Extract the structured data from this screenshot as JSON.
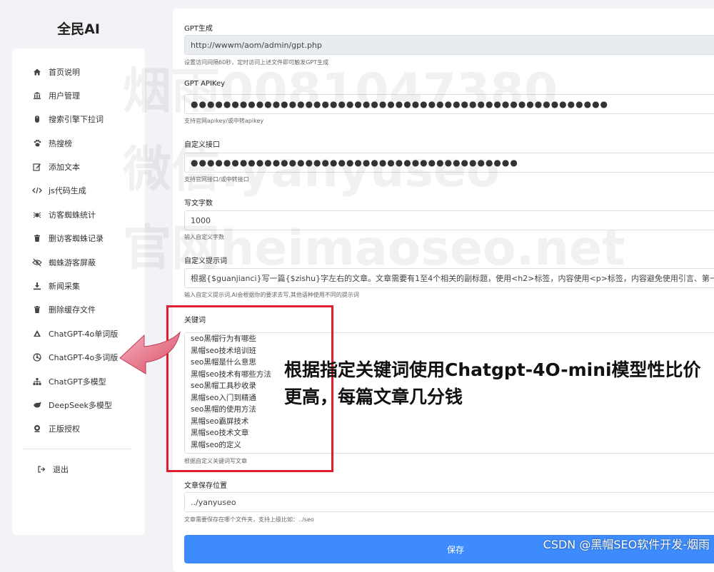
{
  "app": {
    "title": "全民AI"
  },
  "sidebar": {
    "items": [
      {
        "label": "首页说明",
        "icon": "home-icon"
      },
      {
        "label": "用户管理",
        "icon": "users-icon"
      },
      {
        "label": "搜索引擎下拉词",
        "icon": "mouse-icon"
      },
      {
        "label": "热搜榜",
        "icon": "paw-icon"
      },
      {
        "label": "添加文本",
        "icon": "edit-icon"
      },
      {
        "label": "js代码生成",
        "icon": "code-icon"
      },
      {
        "label": "访客蜘蛛统计",
        "icon": "spider-icon"
      },
      {
        "label": "删访客蜘蛛记录",
        "icon": "trash-icon"
      },
      {
        "label": "蜘蛛游客屏蔽",
        "icon": "eye-slash-icon"
      },
      {
        "label": "新闻采集",
        "icon": "download-icon"
      },
      {
        "label": "删除缓存文件",
        "icon": "trash-icon"
      },
      {
        "label": "ChatGPT-4o单词版",
        "icon": "chatgpt-icon"
      },
      {
        "label": "ChatGPT-4o多词版",
        "icon": "chatgpt-icon"
      },
      {
        "label": "ChatGPT多模型",
        "icon": "sitemap-icon"
      },
      {
        "label": "DeepSeek多模型",
        "icon": "deepseek-icon"
      },
      {
        "label": "正版授权",
        "icon": "license-icon"
      }
    ],
    "logout": {
      "label": "退出",
      "icon": "logout-icon"
    }
  },
  "form": {
    "gpt_url": {
      "label": "GPT生成",
      "value": "http://wwwm/aom/admin/gpt.php",
      "hint": "设置访问间隔60秒，定时访问上述文件即可触发GPT生成"
    },
    "api_key": {
      "label": "GPT APIKey",
      "value": "●●●●●●●●●●●●●●●●●●●●●●●●●●●●●●●●●●●●●●●●●●●●●●●●●●●",
      "hint": "支持官网apikey/或中转apikey"
    },
    "custom_api": {
      "label": "自定义接口",
      "value": "●●●●●●●●●●●●●●●●●●●●●●●●●●●●●●●●●●●●●●●●",
      "hint": "支持官网接口/或中转接口"
    },
    "word_count": {
      "label": "写文字数",
      "value": "1000",
      "hint": "输入自定义字数"
    },
    "prompt": {
      "label": "自定义提示词",
      "value": "根据{$guanjianci}写一篇{$zishu}字左右的文章。文章需要有1至4个相关的副标题，使用<h2>标签，内容使用<p>标签，内容避免使用引言、第一、总结",
      "hint": "输入自定义提示词,AI会根据你的要求去写,其他语种使用不同的提示词"
    },
    "keywords": {
      "label": "关键词",
      "lines": [
        "seo黑帽行为有哪些",
        "黑帽seo技术培训班",
        "seo黑帽是什么意思",
        "黑帽seo技术有哪些方法",
        "seo黑帽工具秒收录",
        "黑帽seo入门到精通",
        "seo黑帽的使用方法",
        "黑帽seo霸屏技术",
        "黑帽seo技术文章",
        "黑帽seo的定义"
      ],
      "hint": "根据自定义关键词写文章"
    },
    "save_path": {
      "label": "文章保存位置",
      "value": "../yanyuseo",
      "hint": "文章需要保存在哪个文件夹，支持上级比如：../seo"
    },
    "save_button": "保存"
  },
  "watermark": {
    "line1": "烟雨0081047380",
    "line2": "微信:yanyuseo",
    "line3": "官网heimaoseo.net"
  },
  "annotation": {
    "text": "根据指定关键词使用Chatgpt-4O-mini模型性比价更高，每篇文章几分钱"
  },
  "footer": {
    "credit": "CSDN @黑帽SEO软件开发-烟雨"
  }
}
